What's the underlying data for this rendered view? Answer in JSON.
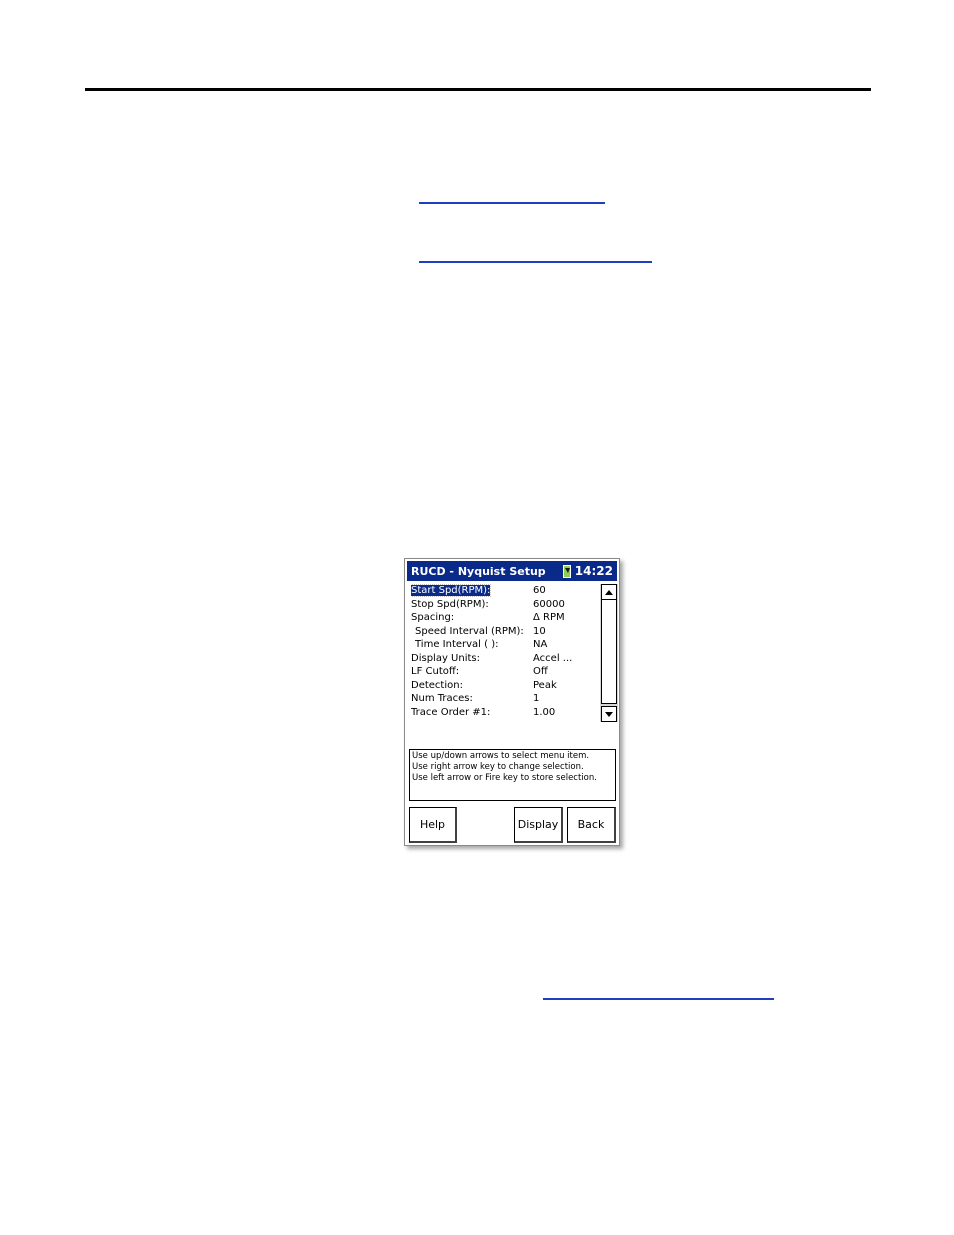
{
  "window": {
    "title": "RUCD - Nyquist Setup",
    "clock": "14:22",
    "battery_icon": "battery-charging-icon"
  },
  "menu": {
    "items": [
      {
        "label": "Start Spd(RPM):",
        "value": "60",
        "selected": true
      },
      {
        "label": "Stop Spd(RPM):",
        "value": "60000"
      },
      {
        "label": "Spacing:",
        "value": "Δ RPM"
      },
      {
        "label": "Speed Interval (RPM):",
        "value": "10",
        "indent": true
      },
      {
        "label": "Time Interval ( ):",
        "value": "NA",
        "indent": true
      },
      {
        "label": "Display Units:",
        "value": "Accel ..."
      },
      {
        "label": "LF Cutoff:",
        "value": "Off"
      },
      {
        "label": "Detection:",
        "value": "Peak"
      },
      {
        "label": "Num Traces:",
        "value": "1"
      },
      {
        "label": "Trace Order #1:",
        "value": "1.00"
      }
    ]
  },
  "help_text": {
    "line1": "Use up/down arrows to select menu item.",
    "line2": "Use right arrow key to change selection.",
    "line3": "Use left arrow or Fire key to store selection."
  },
  "buttons": {
    "help": "Help",
    "display": "Display",
    "back": "Back"
  },
  "colors": {
    "titlebar": "#0a2a8a",
    "selection": "#0a2a8a",
    "link_underline": "#1f3fbf"
  }
}
